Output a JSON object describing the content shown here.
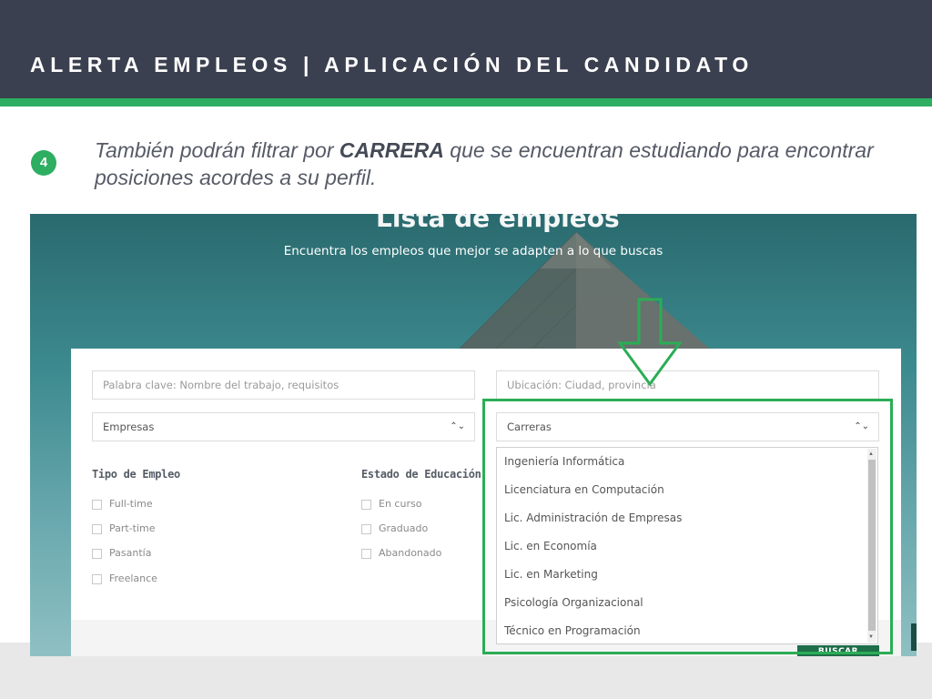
{
  "slide": {
    "title": "ALERTA EMPLEOS | APLICACIÓN DEL CANDIDATO",
    "step_number": "4",
    "instruction_before": "También podrán filtrar por ",
    "instruction_bold": "CARRERA",
    "instruction_after": " que se encuentran estudiando para encontrar posiciones acordes a su perfil."
  },
  "colors": {
    "header_bg": "#3b4050",
    "accent_green": "#2dae61",
    "highlight_green": "#2bad55",
    "button_green": "#1f6e4a"
  },
  "screenshot": {
    "hero_title": "Lista de empleos",
    "hero_subtitle": "Encuentra los empleos que mejor se adapten a lo que buscas",
    "keyword_placeholder": "Palabra clave: Nombre del trabajo, requisitos",
    "location_placeholder": "Ubicación: Ciudad, provincia",
    "companies_select": "Empresas",
    "careers_select": "Carreras",
    "employment_type": {
      "title": "Tipo de Empleo",
      "options": [
        "Full-time",
        "Part-time",
        "Pasantía",
        "Freelance"
      ]
    },
    "education_status": {
      "title": "Estado de Educación",
      "options": [
        "En curso",
        "Graduado",
        "Abandonado"
      ]
    },
    "careers_options": [
      "Ingeniería Informática",
      "Licenciatura en Computación",
      "Lic. Administración de Empresas",
      "Lic. en Economía",
      "Lic. en Marketing",
      "Psicología Organizacional",
      "Técnico en Programación"
    ],
    "search_button": "BUSCAR",
    "icons": {
      "select_caret": "up-down-chevron-icon",
      "pointer": "down-arrow-icon",
      "scroll_up": "scroll-up-icon",
      "scroll_down": "scroll-down-icon"
    }
  }
}
